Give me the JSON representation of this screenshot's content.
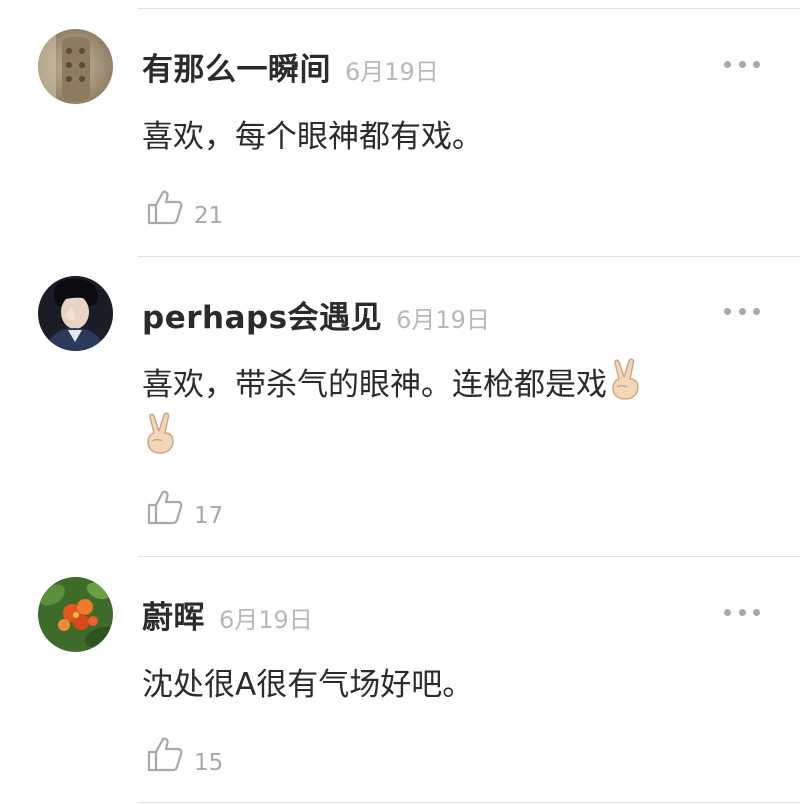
{
  "comments": [
    {
      "username": "有那么一瞬间",
      "date": "6月19日",
      "text": "喜欢，每个眼神都有戏。",
      "likes": "21"
    },
    {
      "username": "perhaps会遇见",
      "date": "6月19日",
      "text": "喜欢，带杀气的眼神。连枪都是戏",
      "emoji": "victory-hand",
      "likes": "17"
    },
    {
      "username": "蔚晖",
      "date": "6月19日",
      "text": "沈处很A很有气场好吧。",
      "likes": "15"
    }
  ],
  "icons": {
    "more": "more-options-icon",
    "like": "thumbs-up-icon",
    "emoji": "victory-hand-emoji"
  },
  "colors": {
    "username": "#2b2b2b",
    "meta": "#b8b8b8",
    "divider": "#e2e2e2"
  }
}
